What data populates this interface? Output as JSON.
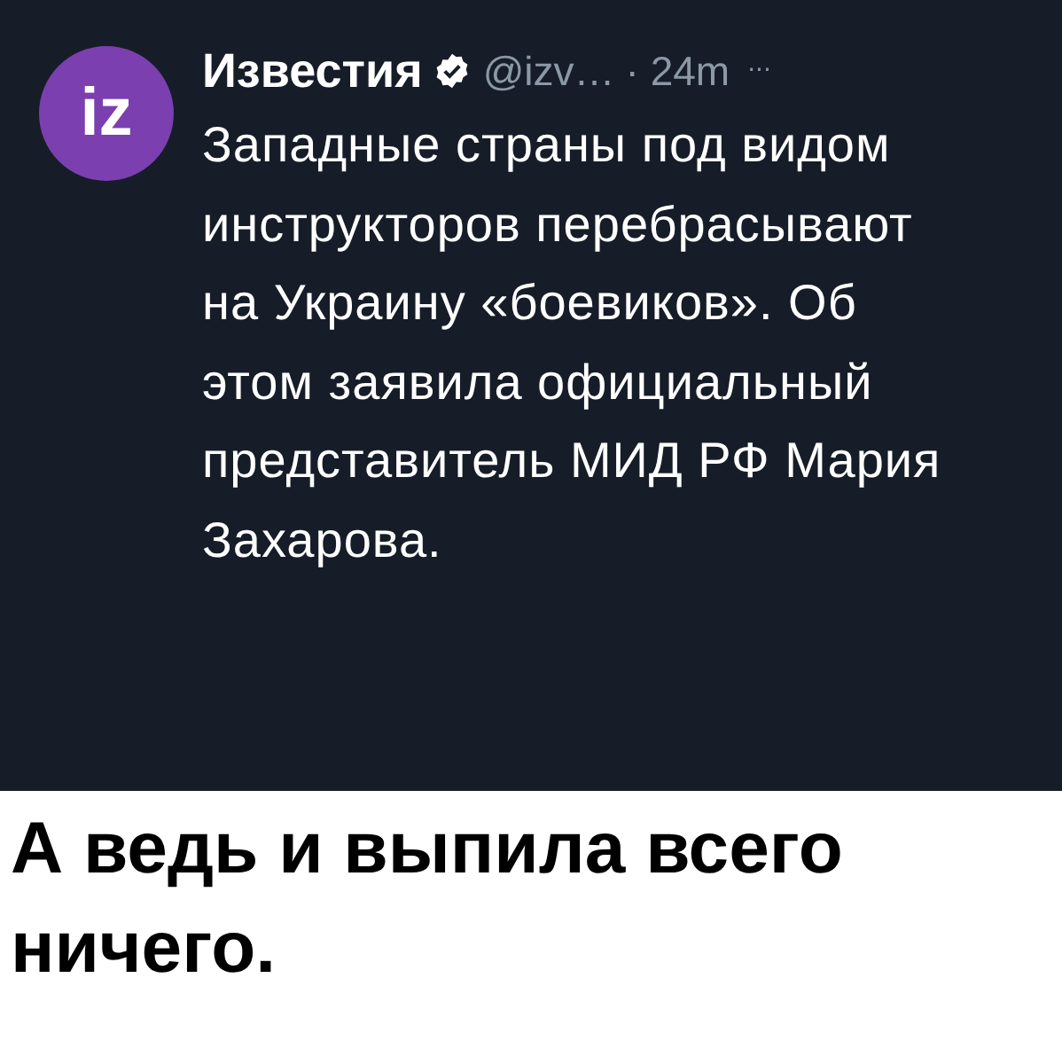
{
  "tweet": {
    "avatar_text": "iz",
    "author": "Известия",
    "verified": true,
    "handle": "@izv…",
    "time": "· 24m",
    "more": "···",
    "text": "Западные страны под видом инструкторов перебрасывают на Украину «боевиков». Об этом заявила официальный представитель МИД РФ Мария Захарова."
  },
  "caption": "А ведь и выпила всего ничего."
}
